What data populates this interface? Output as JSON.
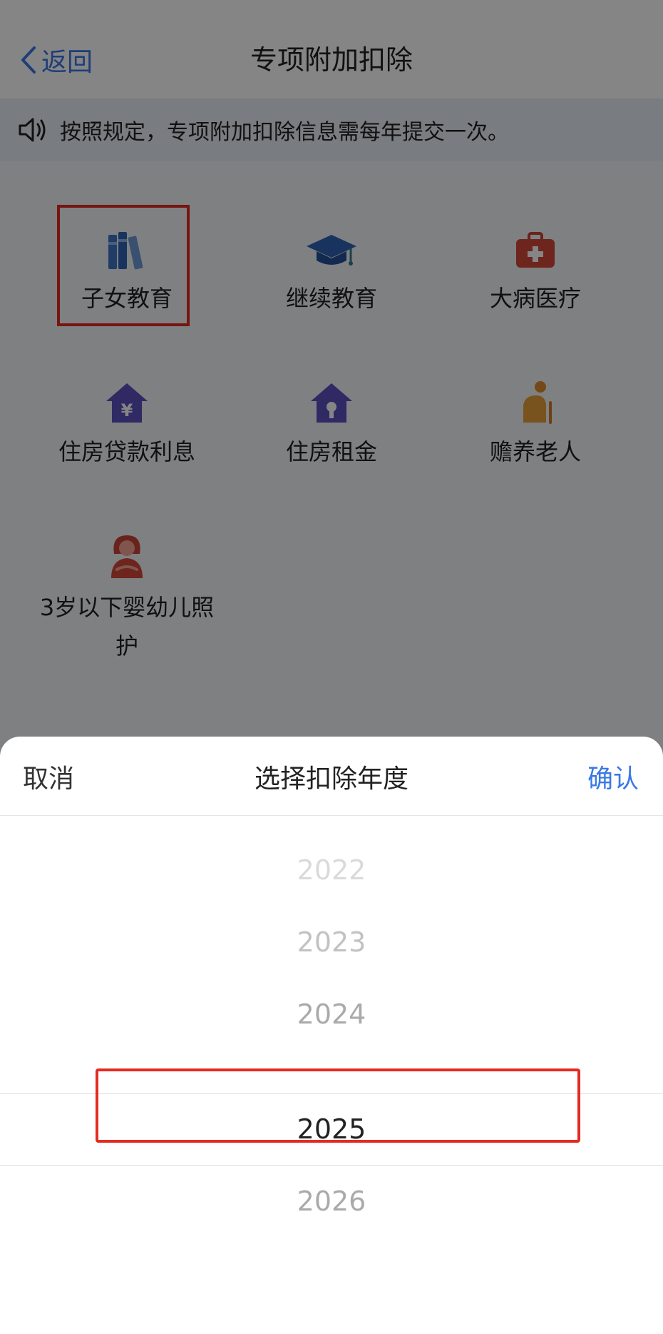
{
  "header": {
    "back_label": "返回",
    "title": "专项附加扣除"
  },
  "notice": {
    "icon": "speaker-icon",
    "text": "按照规定，专项附加扣除信息需每年提交一次。"
  },
  "grid": {
    "items": [
      {
        "label": "子女教育",
        "icon": "books-icon"
      },
      {
        "label": "继续教育",
        "icon": "graduation-cap-icon"
      },
      {
        "label": "大病医疗",
        "icon": "medical-kit-icon"
      },
      {
        "label": "住房贷款利息",
        "icon": "house-yuan-icon"
      },
      {
        "label": "住房租金",
        "icon": "house-key-icon"
      },
      {
        "label": "赡养老人",
        "icon": "elderly-person-icon"
      },
      {
        "label_line1": "3岁以下婴幼儿照",
        "label_line2": "护",
        "icon": "mother-infant-icon"
      }
    ]
  },
  "sheet": {
    "cancel_label": "取消",
    "title": "选择扣除年度",
    "confirm_label": "确认",
    "years": [
      "2022",
      "2023",
      "2024",
      "2025",
      "2026"
    ],
    "selected": "2025"
  },
  "colors": {
    "accent": "#3a78e6",
    "highlight": "#e52a22",
    "overlay": "rgba(0,0,0,0.48)"
  }
}
